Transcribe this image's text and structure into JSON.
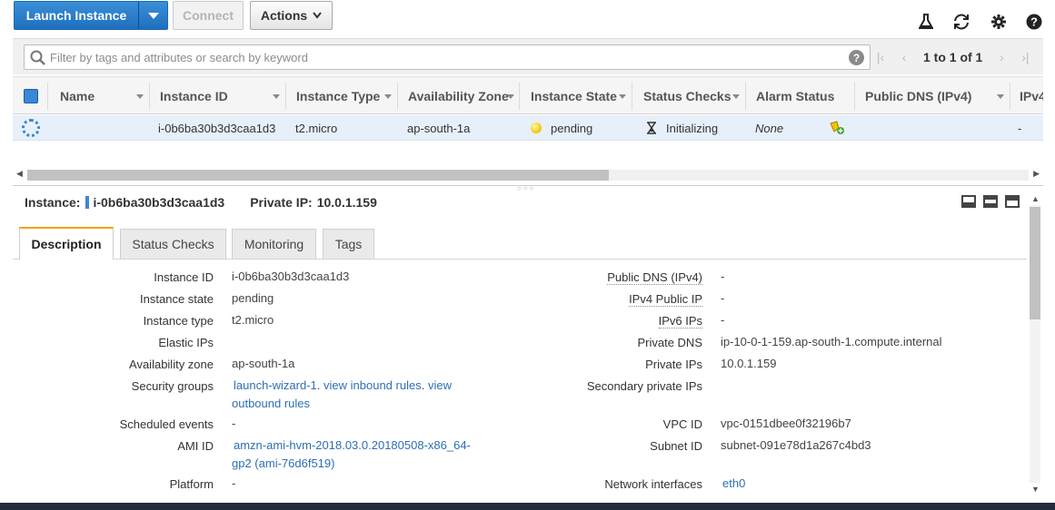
{
  "toolbar": {
    "launch_label": "Launch Instance",
    "connect_label": "Connect",
    "actions_label": "Actions",
    "icons": [
      "flask-icon",
      "refresh-icon",
      "gear-icon",
      "help-icon"
    ]
  },
  "search": {
    "placeholder": "Filter by tags and attributes or search by keyword",
    "help": "?"
  },
  "pager": {
    "text": "1 to 1 of 1"
  },
  "table": {
    "columns": [
      "Name",
      "Instance ID",
      "Instance Type",
      "Availability Zone",
      "Instance State",
      "Status Checks",
      "Alarm Status",
      "Public DNS (IPv4)",
      "IPv4"
    ],
    "row": {
      "name": "",
      "instance_id": "i-0b6ba30b3d3caa1d3",
      "instance_type": "t2.micro",
      "availability_zone": "ap-south-1a",
      "instance_state": "pending",
      "status_checks": "Initializing",
      "alarm_status": "None",
      "public_dns": "",
      "ipv4": "-"
    }
  },
  "details": {
    "instance_label": "Instance:",
    "instance_id": "i-0b6ba30b3d3caa1d3",
    "private_ip_label": "Private IP:",
    "private_ip": "10.0.1.159",
    "tabs": [
      "Description",
      "Status Checks",
      "Monitoring",
      "Tags"
    ],
    "left": [
      {
        "label": "Instance ID",
        "value": "i-0b6ba30b3d3caa1d3"
      },
      {
        "label": "Instance state",
        "value": "pending"
      },
      {
        "label": "Instance type",
        "value": "t2.micro"
      },
      {
        "label": "Elastic IPs",
        "value": ""
      },
      {
        "label": "Availability zone",
        "value": "ap-south-1a"
      },
      {
        "label": "Security groups",
        "value": ""
      },
      {
        "label": "Scheduled events",
        "value": "-"
      },
      {
        "label": "AMI ID",
        "value": ""
      },
      {
        "label": "Platform",
        "value": "-"
      }
    ],
    "security_groups": {
      "group": "launch-wizard-1",
      "sep1": ".",
      "inbound": "view inbound rules",
      "sep2": ".",
      "view": "view",
      "outbound": "outbound rules"
    },
    "ami": {
      "line1": "amzn-ami-hvm-2018.03.0.20180508-x86_64-",
      "line2": "gp2 (ami-76d6f519)"
    },
    "right": [
      {
        "label": "Public DNS (IPv4)",
        "value": "-"
      },
      {
        "label": "IPv4 Public IP",
        "value": "-"
      },
      {
        "label": "IPv6 IPs",
        "value": "-"
      },
      {
        "label": "Private DNS",
        "value": "ip-10-0-1-159.ap-south-1.compute.internal"
      },
      {
        "label": "Private IPs",
        "value": "10.0.1.159"
      },
      {
        "label": "Secondary private IPs",
        "value": ""
      },
      {
        "label": "VPC ID",
        "value": "vpc-0151dbee0f32196b7"
      },
      {
        "label": "Subnet ID",
        "value": "subnet-091e78d1a267c4bd3"
      },
      {
        "label": "Network interfaces",
        "value": "eth0"
      }
    ]
  }
}
